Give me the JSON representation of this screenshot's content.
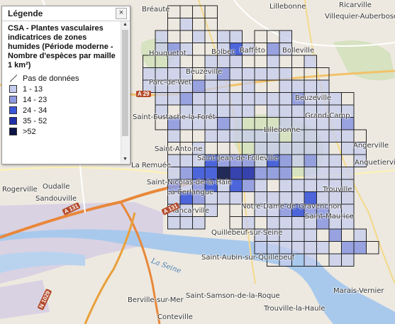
{
  "legend": {
    "title": "Légende",
    "close_symbol": "×",
    "layer_title": "CSA - Plantes vasculaires indicatrices de zones humides (Période moderne - Nombre d'espèces par maille 1 km²)",
    "classes": [
      {
        "label": "Pas de données",
        "color": null
      },
      {
        "label": "1 - 13",
        "color": "#c6ccee"
      },
      {
        "label": "14 - 23",
        "color": "#8e9ae0"
      },
      {
        "label": "24 - 34",
        "color": "#3a56d9"
      },
      {
        "label": "35 - 52",
        "color": "#2130a8"
      },
      {
        "label": ">52",
        "color": "#0b1548"
      }
    ],
    "scroll_up_symbol": "▲",
    "scroll_down_symbol": "▼"
  },
  "places": [
    "Bréauté",
    "Ricarville",
    "Lillebonne",
    "Villequier-Auberbosc",
    "Houquetot",
    "Bolbec",
    "Rafféto",
    "Bolleville",
    "Parc-de-Wet",
    "Beuzeville",
    "Beuzeville",
    "Saint-Eustache-la-Forêt",
    "Grand-Camp",
    "Saint-Antoine",
    "Lillebonne",
    "Angerville",
    "La Remuée",
    "Saint-Nicolas-de-la-Haie",
    "Trouville",
    "Oudalle",
    "Rogerville",
    "Sandouville",
    "La Cerlangue",
    "Tancarville",
    "Quillebeuf-sur-Seine",
    "Saint-Aubin-sur-Quillebeuf",
    "Saint-Samson-de-la-Roque",
    "Berville-sur-Mer",
    "Trouville-la-Haule",
    "Conteville",
    "Marais-Vernier",
    "Anquetierville",
    "Saint-Jean-de-Folleville",
    "Notre-Dame-de-Gravenchon",
    "Saint-Maurice"
  ],
  "roads": [
    "A 131",
    "A 131",
    "N 1029",
    "A 29"
  ],
  "river": "La Seine",
  "grid": {
    "rows": [
      "...........OOOO.........",
      "...........OAOO.........",
      "..........AOOAOAA.OOA...",
      "..........ABAOOACAOBA...",
      ".........OOAOOAAAOOAOOA.",
      ".........AAAAOABAAAAAOOO",
      ".........AAAABAAOAOOAAAA",
      "..........AABAAAAAAAABAAAO",
      "..........AOAAAAAAOAAAAAAA",
      "..........OBAAABAOOOAAAAAB",
      "...........AOOAAAAAAOAAAAAO",
      "...........OOAOOOOAAAAAAOAA",
      "...........AAACBBBACBABAAOA",
      "...........ABCCEDDBBBOAAAA.",
      "...........BABCACBAOAAAAAA.",
      "...........ACBAAAOAAAACAAA.",
      "...........AAOA.OOAABCBBAA.",
      "...........AAA..OAOAAAABAA.",
      "..................AAAAAOBOA.",
      "..................AAAAAAOBBO",
      "...................OAOAOAA.."
    ]
  }
}
